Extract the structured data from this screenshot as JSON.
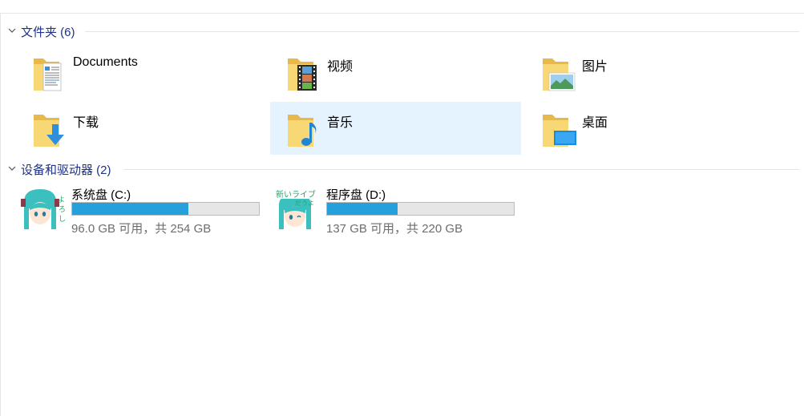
{
  "groups": {
    "folders": {
      "title": "文件夹 (6)"
    },
    "drives": {
      "title": "设备和驱动器 (2)"
    }
  },
  "folders": [
    {
      "label": "Documents",
      "icon": "documents-folder-icon"
    },
    {
      "label": "视频",
      "icon": "videos-folder-icon"
    },
    {
      "label": "图片",
      "icon": "pictures-folder-icon"
    },
    {
      "label": "下载",
      "icon": "downloads-folder-icon"
    },
    {
      "label": "音乐",
      "icon": "music-folder-icon",
      "selected": true
    },
    {
      "label": "桌面",
      "icon": "desktop-folder-icon"
    }
  ],
  "drives": [
    {
      "name": "系统盘 (C:)",
      "info": "96.0 GB 可用，共 254 GB",
      "used_fraction": 0.622,
      "icon": "anime-character-drive-icon"
    },
    {
      "name": "程序盘 (D:)",
      "info": "137 GB 可用，共 220 GB",
      "used_fraction": 0.377,
      "icon": "anime-character-drive-icon"
    }
  ],
  "colors": {
    "group_header": "#1e3287",
    "selection": "#e5f3ff",
    "usage_bar": "#26a0da",
    "folder": "#f6d36b"
  }
}
